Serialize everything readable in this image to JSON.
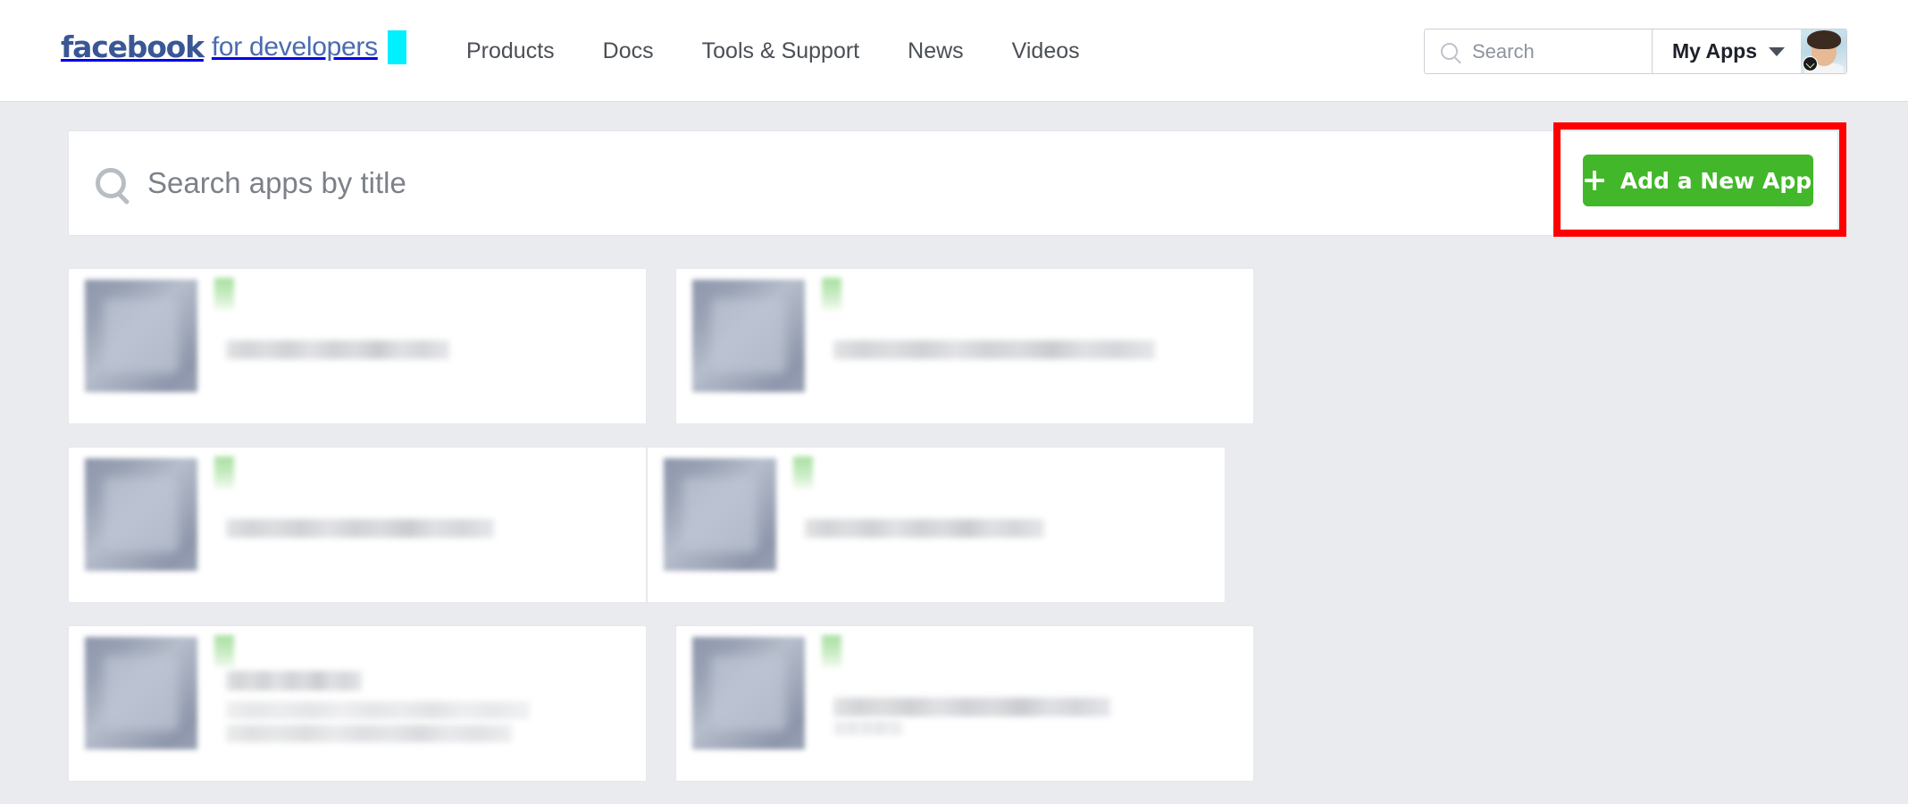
{
  "topbar": {
    "brand": {
      "facebook": "facebook",
      "suffix": "for developers"
    },
    "nav": [
      {
        "label": "Products",
        "name": "nav-products"
      },
      {
        "label": "Docs",
        "name": "nav-docs"
      },
      {
        "label": "Tools & Support",
        "name": "nav-tools-support"
      },
      {
        "label": "News",
        "name": "nav-news"
      },
      {
        "label": "Videos",
        "name": "nav-videos"
      }
    ],
    "search": {
      "placeholder": "Search",
      "value": "",
      "icon": "search-icon"
    },
    "my_apps": {
      "label": "My Apps",
      "icon": "chevron-down-icon",
      "avatar": "user-avatar"
    }
  },
  "app_search": {
    "placeholder": "Search apps by title",
    "value": "",
    "icon": "search-icon"
  },
  "add_app_button": {
    "label": "Add a New App",
    "icon": "plus-icon",
    "color": "#42b72a"
  },
  "annotation": {
    "type": "highlight-box",
    "color": "#ff0000",
    "target": "add-a-new-app-button"
  },
  "colors": {
    "page_background": "#e9ebee",
    "brand_blue": "#3a5795",
    "brand_link_blue": "#4b6bb0",
    "cursor_cyan": "#00f0ff",
    "button_green": "#42b72a",
    "highlight_red": "#ff0000",
    "nav_text": "#4b4f56",
    "placeholder_grey": "#7c8189"
  },
  "app_cards": [
    {
      "name": "app-card-1",
      "title_redacted": true,
      "status": "active",
      "layout": "single-line",
      "variant": "r-a"
    },
    {
      "name": "app-card-2",
      "title_redacted": true,
      "status": "active",
      "layout": "single-line",
      "variant": "r-b"
    },
    {
      "name": "app-card-3",
      "title_redacted": true,
      "status": "active",
      "layout": "single-line",
      "variant": "r-c"
    },
    {
      "name": "app-card-4",
      "title_redacted": true,
      "status": "active",
      "layout": "single-line",
      "variant": "r-d"
    },
    {
      "name": "app-card-5",
      "title_redacted": true,
      "status": "active",
      "layout": "multi-line",
      "variant": "r-e"
    },
    {
      "name": "app-card-6",
      "title_redacted": true,
      "status": "active",
      "layout": "single-line",
      "variant": "r-f"
    }
  ]
}
